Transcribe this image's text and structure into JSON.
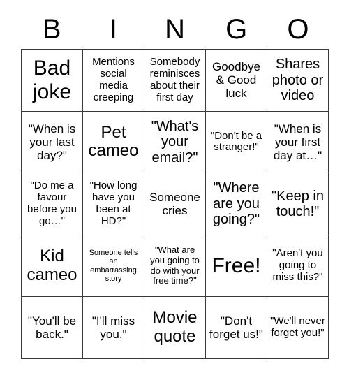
{
  "card": {
    "header_letters": [
      "B",
      "I",
      "N",
      "G",
      "O"
    ],
    "rows": [
      [
        {
          "text": "Bad joke",
          "size": "fs-xxl"
        },
        {
          "text": "Mentions social media creeping",
          "size": "fs-sm"
        },
        {
          "text": "Somebody reminisces about their first day",
          "size": "fs-sm"
        },
        {
          "text": "Goodbye & Good luck",
          "size": "fs-md"
        },
        {
          "text": "Shares photo or video",
          "size": "fs-lg"
        }
      ],
      [
        {
          "text": "\"When is your last day?\"",
          "size": "fs-md"
        },
        {
          "text": "Pet cameo",
          "size": "fs-xl"
        },
        {
          "text": "\"What's your email?\"",
          "size": "fs-lg"
        },
        {
          "text": "\"Don't be a stranger!\"",
          "size": "fs-sm"
        },
        {
          "text": "\"When is your first day at…\"",
          "size": "fs-md"
        }
      ],
      [
        {
          "text": "\"Do me a favour before you go…\"",
          "size": "fs-sm"
        },
        {
          "text": "\"How long have you been at HD?\"",
          "size": "fs-sm"
        },
        {
          "text": "Someone cries",
          "size": "fs-md"
        },
        {
          "text": "\"Where are you going?\"",
          "size": "fs-lg"
        },
        {
          "text": "\"Keep in touch!\"",
          "size": "fs-lg"
        }
      ],
      [
        {
          "text": "Kid cameo",
          "size": "fs-xl"
        },
        {
          "text": "Someone tells an embarrassing story",
          "size": "fs-xxs"
        },
        {
          "text": "\"What are you going to do with your free time?\"",
          "size": "fs-xs"
        },
        {
          "text": "Free!",
          "size": "fs-xxl"
        },
        {
          "text": "\"Aren't you going to miss this?\"",
          "size": "fs-sm"
        }
      ],
      [
        {
          "text": "\"You'll be back.\"",
          "size": "fs-md"
        },
        {
          "text": "\"I'll miss you.\"",
          "size": "fs-md"
        },
        {
          "text": "Movie quote",
          "size": "fs-xl"
        },
        {
          "text": "\"Don't forget us!\"",
          "size": "fs-md"
        },
        {
          "text": "\"We'll never forget you!\"",
          "size": "fs-sm"
        }
      ]
    ]
  }
}
